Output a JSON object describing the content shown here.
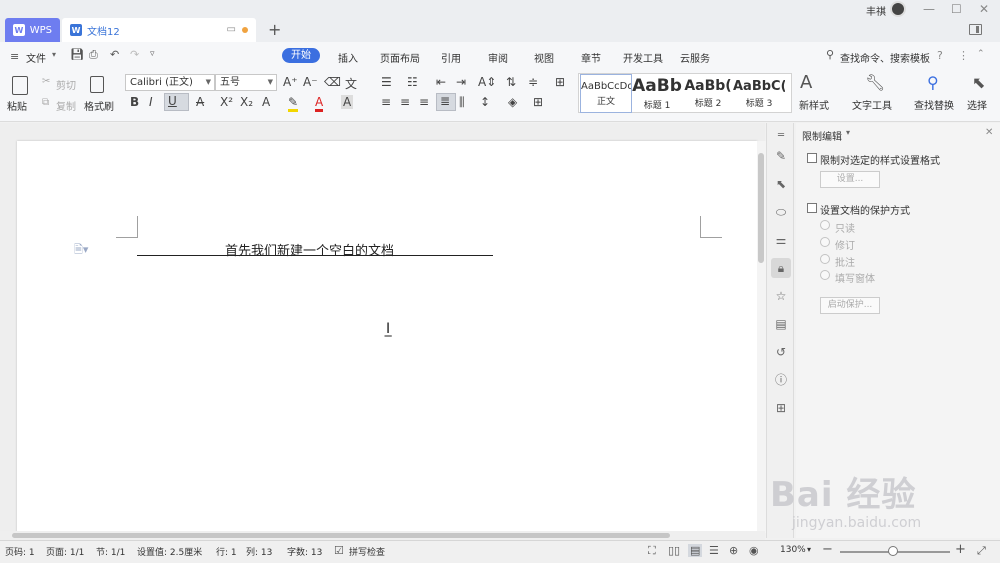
{
  "titlebar": {
    "tabs": [
      {
        "label": "WPS",
        "icon": "wps-logo-icon"
      },
      {
        "label": "文档12",
        "icon": "doc-icon"
      }
    ],
    "user_name": "丰祺",
    "colors": {
      "tab_wps": "#6e7df0",
      "tab_doc_text": "#3a74d8",
      "modified_dot": "#f0a340"
    }
  },
  "menubar": {
    "file_label": "文件",
    "items": [
      "开始",
      "插入",
      "页面布局",
      "引用",
      "审阅",
      "视图",
      "章节",
      "开发工具",
      "云服务"
    ],
    "active": "开始",
    "search_label": "查找命令、搜索模板",
    "accent": "#3b6fe0"
  },
  "ribbon": {
    "paste": "粘贴",
    "cut": "剪切",
    "copy": "复制",
    "format_painter": "格式刷",
    "font_name": "Calibri (正文)",
    "font_size": "五号",
    "styles": [
      {
        "preview": "AaBbCcDd",
        "label": "正文"
      },
      {
        "preview": "AaBb",
        "label": "标题 1"
      },
      {
        "preview": "AaBb(",
        "label": "标题 2"
      },
      {
        "preview": "AaBbC(",
        "label": "标题 3"
      }
    ],
    "new_style": "新样式",
    "text_tools": "文字工具",
    "find_replace": "查找替换",
    "select": "选择"
  },
  "document": {
    "text": "首先我们新建一个空白的文档"
  },
  "panel": {
    "title": "限制编辑",
    "restrict_format": "限制对选定的样式设置格式",
    "settings_button": "设置...",
    "protect_mode": "设置文档的保护方式",
    "options": [
      "只读",
      "修订",
      "批注",
      "填写窗体"
    ],
    "start_protect": "启动保护..."
  },
  "statusbar": {
    "page_num": "页码: 1",
    "page": "页面: 1/1",
    "section": "节: 1/1",
    "setting": "设置值: 2.5厘米",
    "row": "行: 1",
    "col": "列: 13",
    "word_count": "字数: 13",
    "spell_check": "拼写检查",
    "zoom": "130%",
    "zoom_fraction": 0.48
  },
  "watermark": {
    "brand": "Bai 经验",
    "url": "jingyan.baidu.com"
  }
}
